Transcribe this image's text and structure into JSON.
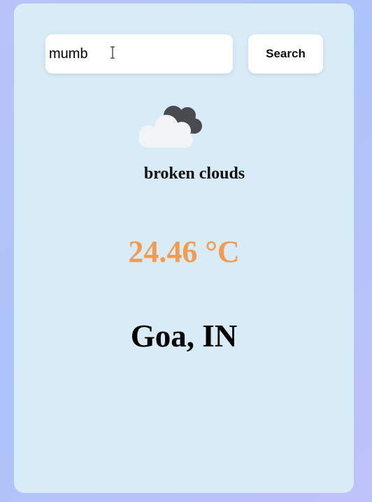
{
  "search": {
    "value": "mumb",
    "button_label": "Search"
  },
  "weather": {
    "icon": "broken-clouds-icon",
    "description": "broken clouds",
    "temperature": "24.46 °C",
    "location": "Goa, IN"
  },
  "colors": {
    "background": "#b9c3f7",
    "card": "#d8ecf8",
    "temperature": "#f39b4e"
  }
}
